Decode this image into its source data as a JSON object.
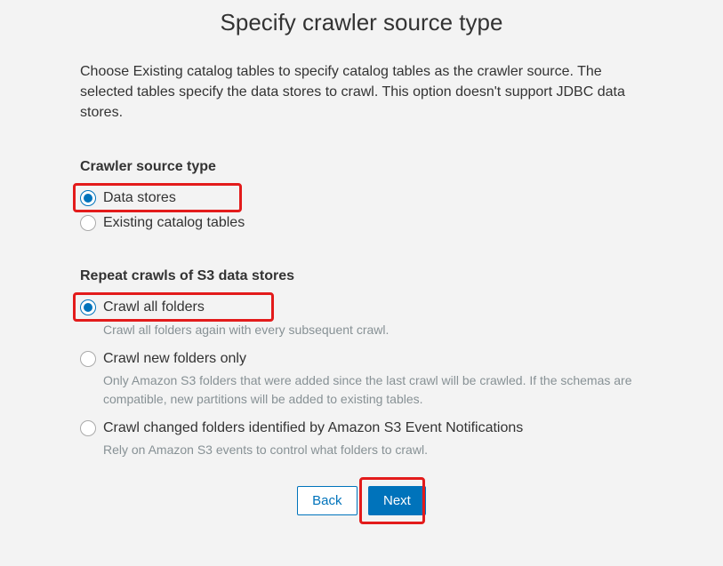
{
  "title": "Specify crawler source type",
  "intro": "Choose Existing catalog tables to specify catalog tables as the crawler source. The selected tables specify the data stores to crawl. This option doesn't support JDBC data stores.",
  "source_type": {
    "heading": "Crawler source type",
    "options": [
      {
        "label": "Data stores",
        "selected": true
      },
      {
        "label": "Existing catalog tables",
        "selected": false
      }
    ]
  },
  "repeat_crawls": {
    "heading": "Repeat crawls of S3 data stores",
    "options": [
      {
        "label": "Crawl all folders",
        "hint": "Crawl all folders again with every subsequent crawl.",
        "selected": true
      },
      {
        "label": "Crawl new folders only",
        "hint": "Only Amazon S3 folders that were added since the last crawl will be crawled. If the schemas are compatible, new partitions will be added to existing tables.",
        "selected": false
      },
      {
        "label": "Crawl changed folders identified by Amazon S3 Event Notifications",
        "hint": "Rely on Amazon S3 events to control what folders to crawl.",
        "selected": false
      }
    ]
  },
  "buttons": {
    "back": "Back",
    "next": "Next"
  }
}
